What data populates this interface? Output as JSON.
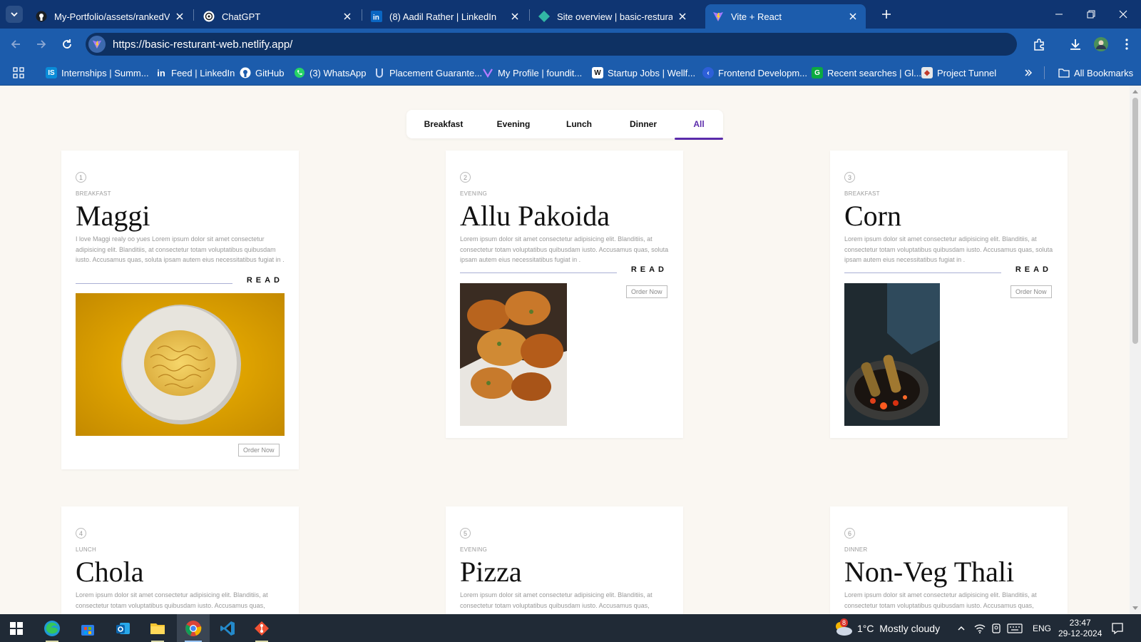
{
  "browser": {
    "tabs": [
      {
        "title": "My-Portfolio/assets/rankedVote",
        "icon": "github-icon"
      },
      {
        "title": "ChatGPT",
        "icon": "chatgpt-icon"
      },
      {
        "title": "(8) Aadil Rather | LinkedIn",
        "icon": "linkedin-icon"
      },
      {
        "title": "Site overview | basic-resturant-w",
        "icon": "netlify-icon"
      },
      {
        "title": "Vite + React",
        "icon": "vite-icon"
      }
    ],
    "active_tab": 4,
    "url_prefix": "https://",
    "url": "https://basic-resturant-web.netlify.app/",
    "bookmarks": [
      {
        "label": "Internships | Summ...",
        "icon": "internshala-icon",
        "color": "#0a8cd8"
      },
      {
        "label": "Feed | LinkedIn",
        "icon": "linkedin-icon",
        "color": "#0a66c2"
      },
      {
        "label": "GitHub",
        "icon": "github-icon",
        "color": "#222222"
      },
      {
        "label": "(3) WhatsApp",
        "icon": "whatsapp-icon",
        "color": "#25d366"
      },
      {
        "label": "Placement Guarante...",
        "icon": "placement-icon",
        "color": "#3b5fa8"
      },
      {
        "label": "My Profile | foundit...",
        "icon": "foundit-icon",
        "color": "#6a3fb8"
      },
      {
        "label": "Startup Jobs | Wellf...",
        "icon": "wellfound-icon",
        "color": "#ffffff"
      },
      {
        "label": "Frontend Developm...",
        "icon": "frontend-icon",
        "color": "#2d5fd8"
      },
      {
        "label": "Recent searches | Gl...",
        "icon": "glassdoor-icon",
        "color": "#0caa41"
      },
      {
        "label": "Project Tunnel",
        "icon": "project-tunnel-icon",
        "color": "#e8e8e8"
      }
    ],
    "all_bookmarks": "All Bookmarks"
  },
  "filter_tabs": [
    "Breakfast",
    "Evening",
    "Lunch",
    "Dinner",
    "All"
  ],
  "active_filter": "All",
  "read_label": "READ",
  "order_label": "Order Now",
  "cards": [
    {
      "num": "1",
      "category": "BREAKFAST",
      "title": "Maggi",
      "desc": "I love Maggi realy oo yues Lorem ipsum dolor sit amet consectetur adipisicing elit. Blanditiis, at consectetur totam voluptatibus quibusdam iusto. Accusamus quas, soluta ipsam autem eius necessitatibus fugiat in ."
    },
    {
      "num": "2",
      "category": "EVENING",
      "title": "Allu Pakoida",
      "desc": "Lorem ipsum dolor sit amet consectetur adipisicing elit. Blanditiis, at consectetur totam voluptatibus quibusdam iusto. Accusamus quas, soluta ipsam autem eius necessitatibus fugiat in ."
    },
    {
      "num": "3",
      "category": "BREAKFAST",
      "title": "Corn",
      "desc": "Lorem ipsum dolor sit amet consectetur adipisicing elit. Blanditiis, at consectetur totam voluptatibus quibusdam iusto. Accusamus quas, soluta ipsam autem eius necessitatibus fugiat in ."
    },
    {
      "num": "4",
      "category": "LUNCH",
      "title": "Chola",
      "desc": "Lorem ipsum dolor sit amet consectetur adipisicing elit. Blanditiis, at consectetur totam voluptatibus quibusdam iusto. Accusamus quas,"
    },
    {
      "num": "5",
      "category": "EVENING",
      "title": "Pizza",
      "desc": "Lorem ipsum dolor sit amet consectetur adipisicing elit. Blanditiis, at consectetur totam voluptatibus quibusdam iusto. Accusamus quas,"
    },
    {
      "num": "6",
      "category": "DINNER",
      "title": "Non-Veg Thali",
      "desc": "Lorem ipsum dolor sit amet consectetur adipisicing elit. Blanditiis, at consectetur totam voluptatibus quibusdam iusto. Accusamus quas,"
    }
  ],
  "taskbar": {
    "apps": [
      "windows-start-icon",
      "edge-icon",
      "store-icon",
      "outlook-icon",
      "file-explorer-icon",
      "chrome-icon",
      "vscode-icon",
      "git-icon"
    ],
    "weather_badge": "8",
    "weather": "1°C  Mostly cloudy",
    "language": "ENG",
    "time": "23:47",
    "date": "29-12-2024"
  },
  "colors": {
    "accent": "#5b2bab",
    "chrome_dark": "#0f3572",
    "chrome": "#1c5cac",
    "page_bg": "#faf7f2"
  }
}
